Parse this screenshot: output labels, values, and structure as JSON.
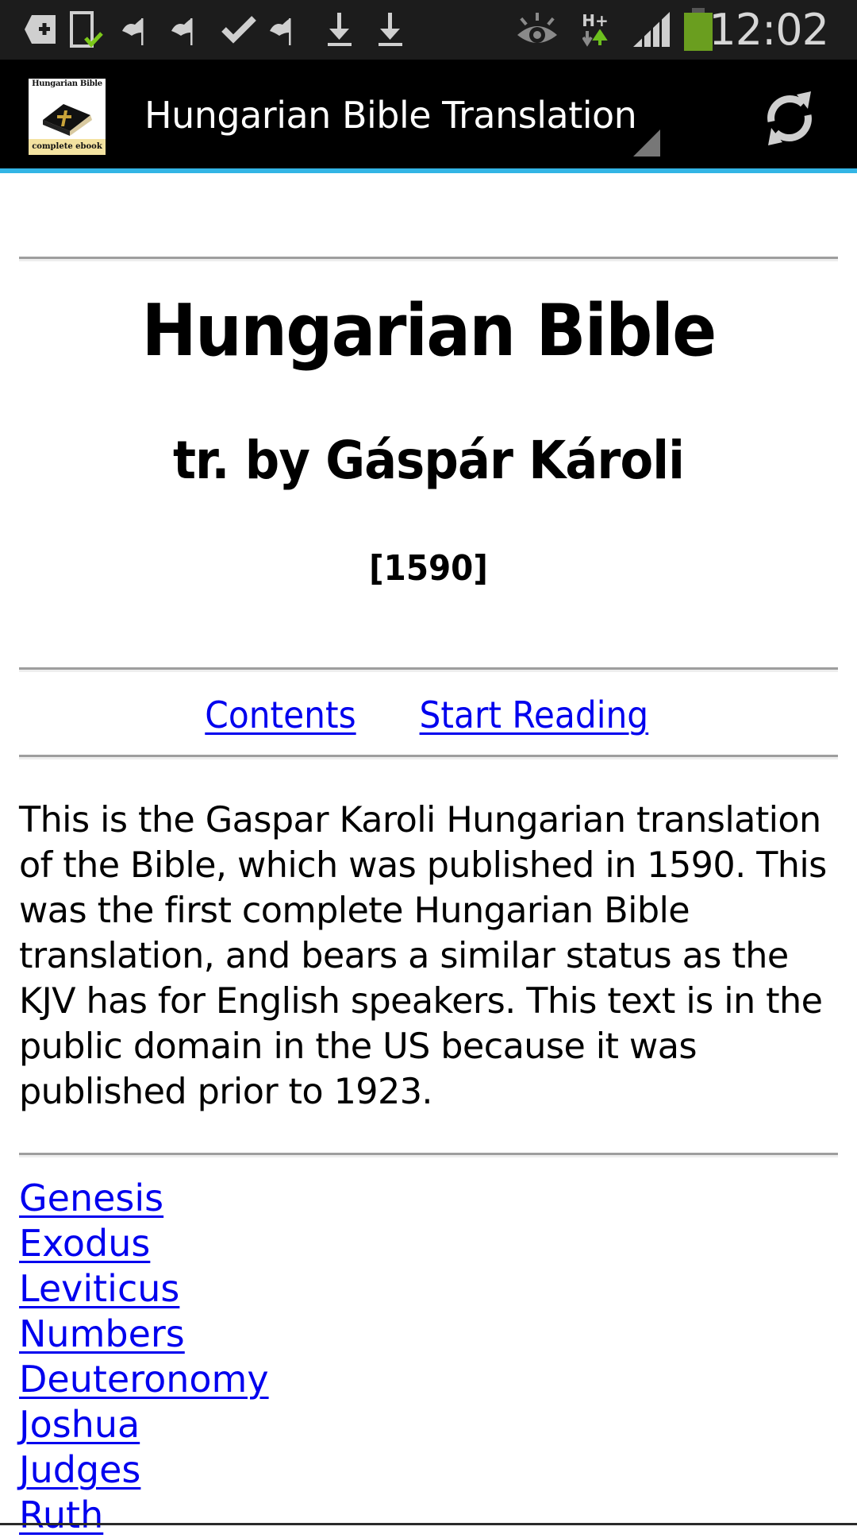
{
  "status_bar": {
    "time": "12:02",
    "network_type": "H+",
    "battery_color": "#6a9e1f",
    "icons": [
      "add-tab-icon",
      "phone-check-icon",
      "flag-icon",
      "flag-icon",
      "check-icon",
      "flag-icon",
      "download-icon",
      "download-icon",
      "eye-icon",
      "network-hplus-icon",
      "signal-icon",
      "battery-icon"
    ]
  },
  "action_bar": {
    "title": "Hungarian Bible Translation",
    "logo_top_text": "Hungarian Bible",
    "logo_bottom_text": "complete ebook",
    "accent_color": "#33b5e5",
    "refresh_icon": "refresh-icon"
  },
  "document": {
    "title": "Hungarian Bible",
    "subtitle": "tr. by Gáspár Károli",
    "year": "[1590]",
    "nav_links": {
      "contents": "Contents",
      "start_reading": "Start Reading"
    },
    "description": "This is the Gaspar Karoli Hungarian translation of the Bible, which was published in 1590. This was the first complete Hungarian Bible translation, and bears a similar status as the KJV has for English speakers. This text is in the public domain in the US because it was published prior to 1923.",
    "books": [
      "Genesis",
      "Exodus",
      "Leviticus",
      "Numbers",
      "Deuteronomy",
      "Joshua",
      "Judges",
      "Ruth"
    ],
    "link_color": "#0000ee"
  }
}
